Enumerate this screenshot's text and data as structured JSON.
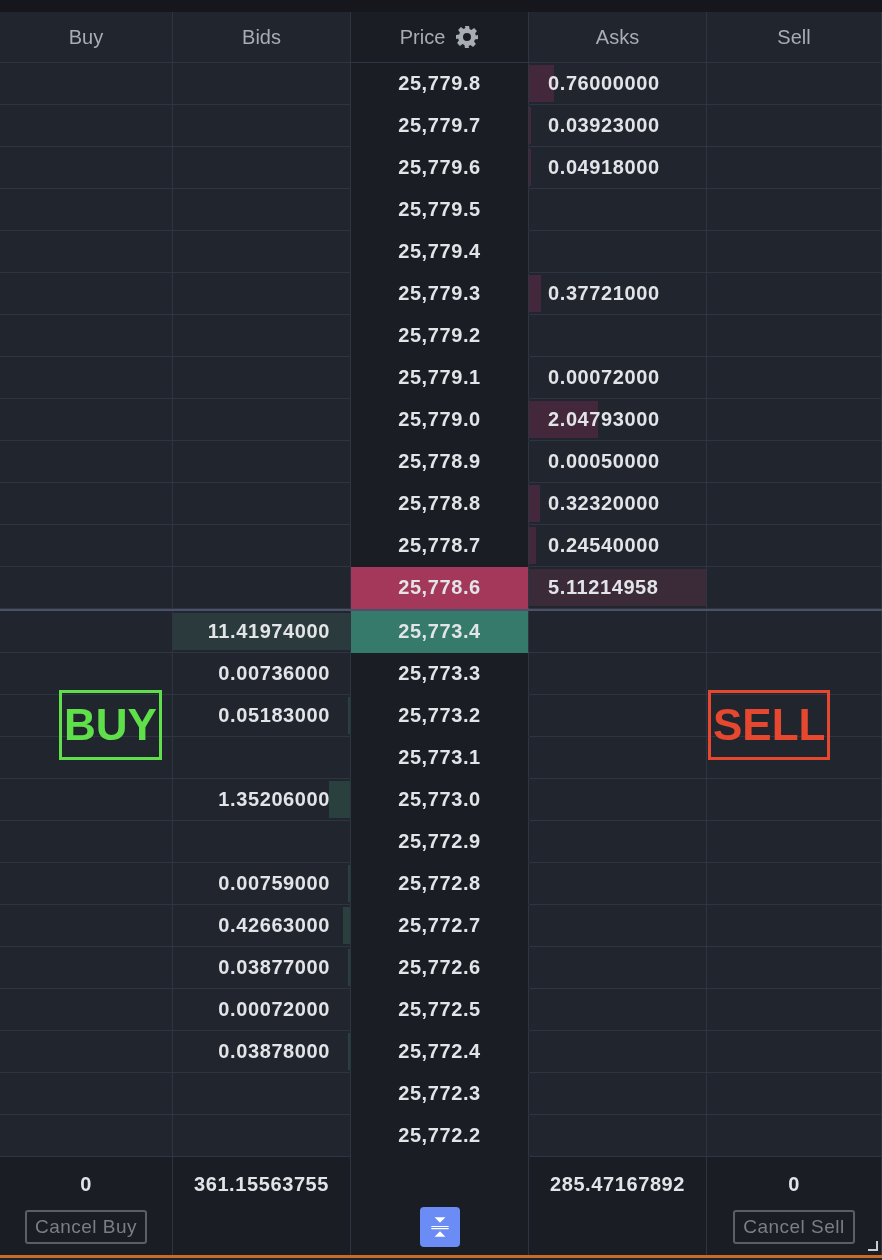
{
  "columns": [
    {
      "label": "Buy"
    },
    {
      "label": "Bids"
    },
    {
      "label": "Price"
    },
    {
      "label": "Asks"
    },
    {
      "label": "Sell"
    }
  ],
  "asks": [
    {
      "price": "25,779.8",
      "size": "0.76000000",
      "level": 0.14,
      "best": false
    },
    {
      "price": "25,779.7",
      "size": "0.03923000",
      "level": 0.01,
      "best": false
    },
    {
      "price": "25,779.6",
      "size": "0.04918000",
      "level": 0.01,
      "best": false
    },
    {
      "price": "25,779.5",
      "best": false
    },
    {
      "price": "25,779.4",
      "best": false
    },
    {
      "price": "25,779.3",
      "size": "0.37721000",
      "level": 0.07,
      "best": false
    },
    {
      "price": "25,779.2",
      "best": false
    },
    {
      "price": "25,779.1",
      "size": "0.00072000",
      "best": false
    },
    {
      "price": "25,779.0",
      "size": "2.04793000",
      "level": 0.39,
      "best": false
    },
    {
      "price": "25,778.9",
      "size": "0.00050000",
      "best": false
    },
    {
      "price": "25,778.8",
      "size": "0.32320000",
      "level": 0.06,
      "best": false
    },
    {
      "price": "25,778.7",
      "size": "0.24540000",
      "level": 0.04,
      "best": false
    },
    {
      "price": "25,778.6",
      "size": "5.11214958",
      "level": 1,
      "best": true
    }
  ],
  "bids": [
    {
      "price": "25,773.4",
      "size": "11.41974000",
      "level": 1,
      "best": true
    },
    {
      "price": "25,773.3",
      "size": "0.00736000",
      "best": false
    },
    {
      "price": "25,773.2",
      "size": "0.05183000",
      "level": 0.01,
      "best": false
    },
    {
      "price": "25,773.1",
      "best": false
    },
    {
      "price": "25,773.0",
      "size": "1.35206000",
      "level": 0.12,
      "best": false
    },
    {
      "price": "25,772.9",
      "best": false
    },
    {
      "price": "25,772.8",
      "size": "0.00759000",
      "level": 0.01,
      "best": false
    },
    {
      "price": "25,772.7",
      "size": "0.42663000",
      "level": 0.04,
      "best": false
    },
    {
      "price": "25,772.6",
      "size": "0.03877000",
      "level": 0.01,
      "best": false
    },
    {
      "price": "25,772.5",
      "size": "0.00072000",
      "best": false
    },
    {
      "price": "25,772.4",
      "size": "0.03878000",
      "level": 0.01,
      "best": false
    },
    {
      "price": "25,772.3",
      "best": false
    },
    {
      "price": "25,772.2",
      "best": false
    }
  ],
  "overlays": [
    {
      "text": "BUY",
      "color": "#5fe04a",
      "kind": "buy"
    },
    {
      "text": "SELL",
      "color": "#e5472f",
      "kind": "sell"
    }
  ],
  "footer": {
    "buy_count": "0",
    "bids_total": "361.15563755",
    "asks_total": "285.47167892",
    "sell_count": "0",
    "cancel_buy": "Cancel Buy",
    "cancel_sell": "Cancel Sell"
  }
}
